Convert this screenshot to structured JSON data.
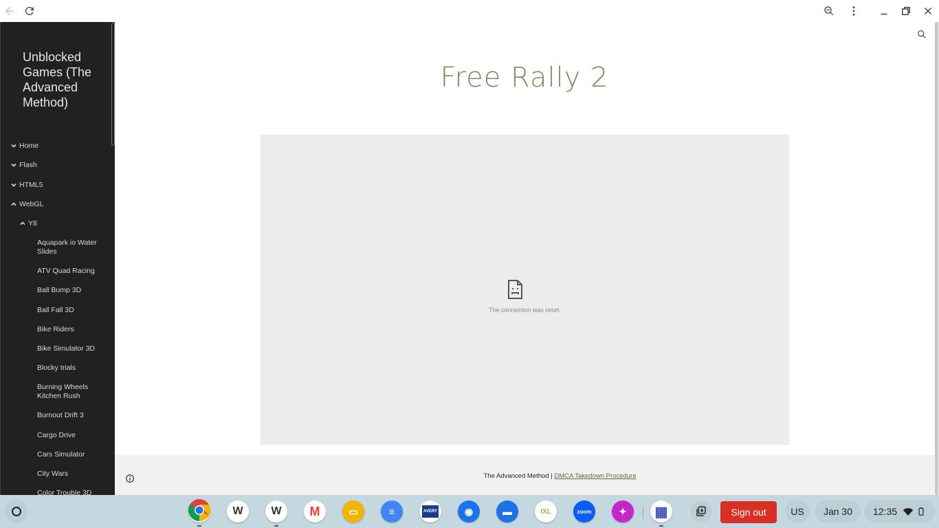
{
  "browser": {
    "back_icon": "arrow-left-icon",
    "reload_icon": "reload-icon",
    "zoom_icon": "zoom-out-icon",
    "menu_icon": "more-vert-icon",
    "minimize_icon": "minimize-icon",
    "restore_icon": "restore-icon",
    "close_icon": "close-icon"
  },
  "sidebar": {
    "site_title": "Unblocked Games (The Advanced Method)",
    "nav": [
      {
        "label": "Home",
        "level": 1,
        "expanded": false
      },
      {
        "label": "Flash",
        "level": 1,
        "expanded": false
      },
      {
        "label": "HTML5",
        "level": 1,
        "expanded": false
      },
      {
        "label": "WebGL",
        "level": 1,
        "expanded": true
      },
      {
        "label": "Y8",
        "level": 2,
        "expanded": true
      }
    ],
    "games": [
      "Aquapark io Water Slides",
      "ATV Quad Racing",
      "Ball Bump 3D",
      "Ball Fall 3D",
      "Bike Riders",
      "Bike Simulator 3D",
      "Blocky trials",
      "Burning Wheels Kitchen Rush",
      "Burnout Drift 3",
      "Cargo Drive",
      "Cars Simulator",
      "City Wars",
      "Color Trouble 3D"
    ]
  },
  "main": {
    "page_title": "Free Rally 2",
    "embed_error": "The connection was reset.",
    "embed_icon": "sad-file-icon",
    "search_icon": "search-icon",
    "footer": {
      "site_name": "The Advanced Method | ",
      "link": "DMCA Takedown Procedure",
      "info_icon": "info-icon"
    }
  },
  "shelf": {
    "apps": [
      {
        "name": "Chrome",
        "icon": "chrome-icon",
        "bg": "#ffffff",
        "text": "",
        "open": true
      },
      {
        "name": "Weebly",
        "icon": "weebly-icon",
        "bg": "#ffffff",
        "text": "W",
        "open": false
      },
      {
        "name": "Weebly",
        "icon": "weebly-icon",
        "bg": "#ffffff",
        "text": "W",
        "open": true
      },
      {
        "name": "Gmail",
        "icon": "gmail-icon",
        "bg": "#ffffff",
        "text": "M",
        "open": false
      },
      {
        "name": "Google Slides",
        "icon": "slides-icon",
        "bg": "#f4b400",
        "text": "▭",
        "open": false
      },
      {
        "name": "Google Docs",
        "icon": "docs-icon",
        "bg": "#4285f4",
        "text": "≡",
        "open": false
      },
      {
        "name": "Avery",
        "icon": "avery-icon",
        "bg": "#ffffff",
        "text": "AVERY",
        "open": false
      },
      {
        "name": "Camera",
        "icon": "camera-icon",
        "bg": "#1a73e8",
        "text": "◉",
        "open": false
      },
      {
        "name": "Files",
        "icon": "files-icon",
        "bg": "#1a73e8",
        "text": "▬",
        "open": false
      },
      {
        "name": "IXL",
        "icon": "ixl-icon",
        "bg": "#ffffff",
        "text": "IXL",
        "open": false
      },
      {
        "name": "Zoom",
        "icon": "zoom-icon",
        "bg": "#0b5cff",
        "text": "zoom",
        "open": false
      },
      {
        "name": "Canvas Notes",
        "icon": "sparkle-icon",
        "bg": "#c626c8",
        "text": "✦",
        "open": false
      },
      {
        "name": "Web App",
        "icon": "webapp-icon",
        "bg": "#ffffff",
        "text": "▦",
        "open": true
      }
    ],
    "screenshot_icon": "screen-capture-icon",
    "sign_out": "Sign out",
    "ime": "US",
    "date": "Jan 30",
    "time": "12:35",
    "wifi_icon": "wifi-icon",
    "battery_icon": "battery-icon",
    "colors": {
      "sign_out_bg": "#d93025",
      "shelf_bg": "#c5d8df"
    }
  }
}
